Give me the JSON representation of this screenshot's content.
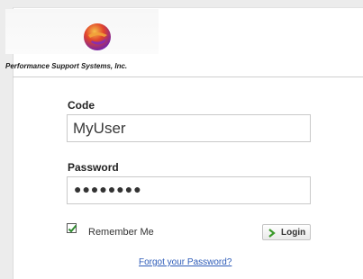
{
  "brand": {
    "company_name": "Performance Support Systems, Inc.",
    "logo_icon": "psi-logo-icon",
    "logo_colors": [
      "#e2452a",
      "#f0a53a",
      "#6a1fb5"
    ]
  },
  "form": {
    "code_label": "Code",
    "code_value": "MyUser",
    "password_label": "Password",
    "password_value": "●●●●●●●●",
    "remember_me": {
      "label": "Remember Me",
      "checked": true,
      "check_color": "#2f8a2f"
    },
    "login_button": {
      "label": "Login",
      "icon": "chevron-right-icon",
      "icon_color": "#3a9a2a"
    },
    "forgot_link": "Forgot your Password?"
  },
  "colors": {
    "background": "#ececec",
    "panel": "#ffffff",
    "link": "#2d5bb8"
  }
}
